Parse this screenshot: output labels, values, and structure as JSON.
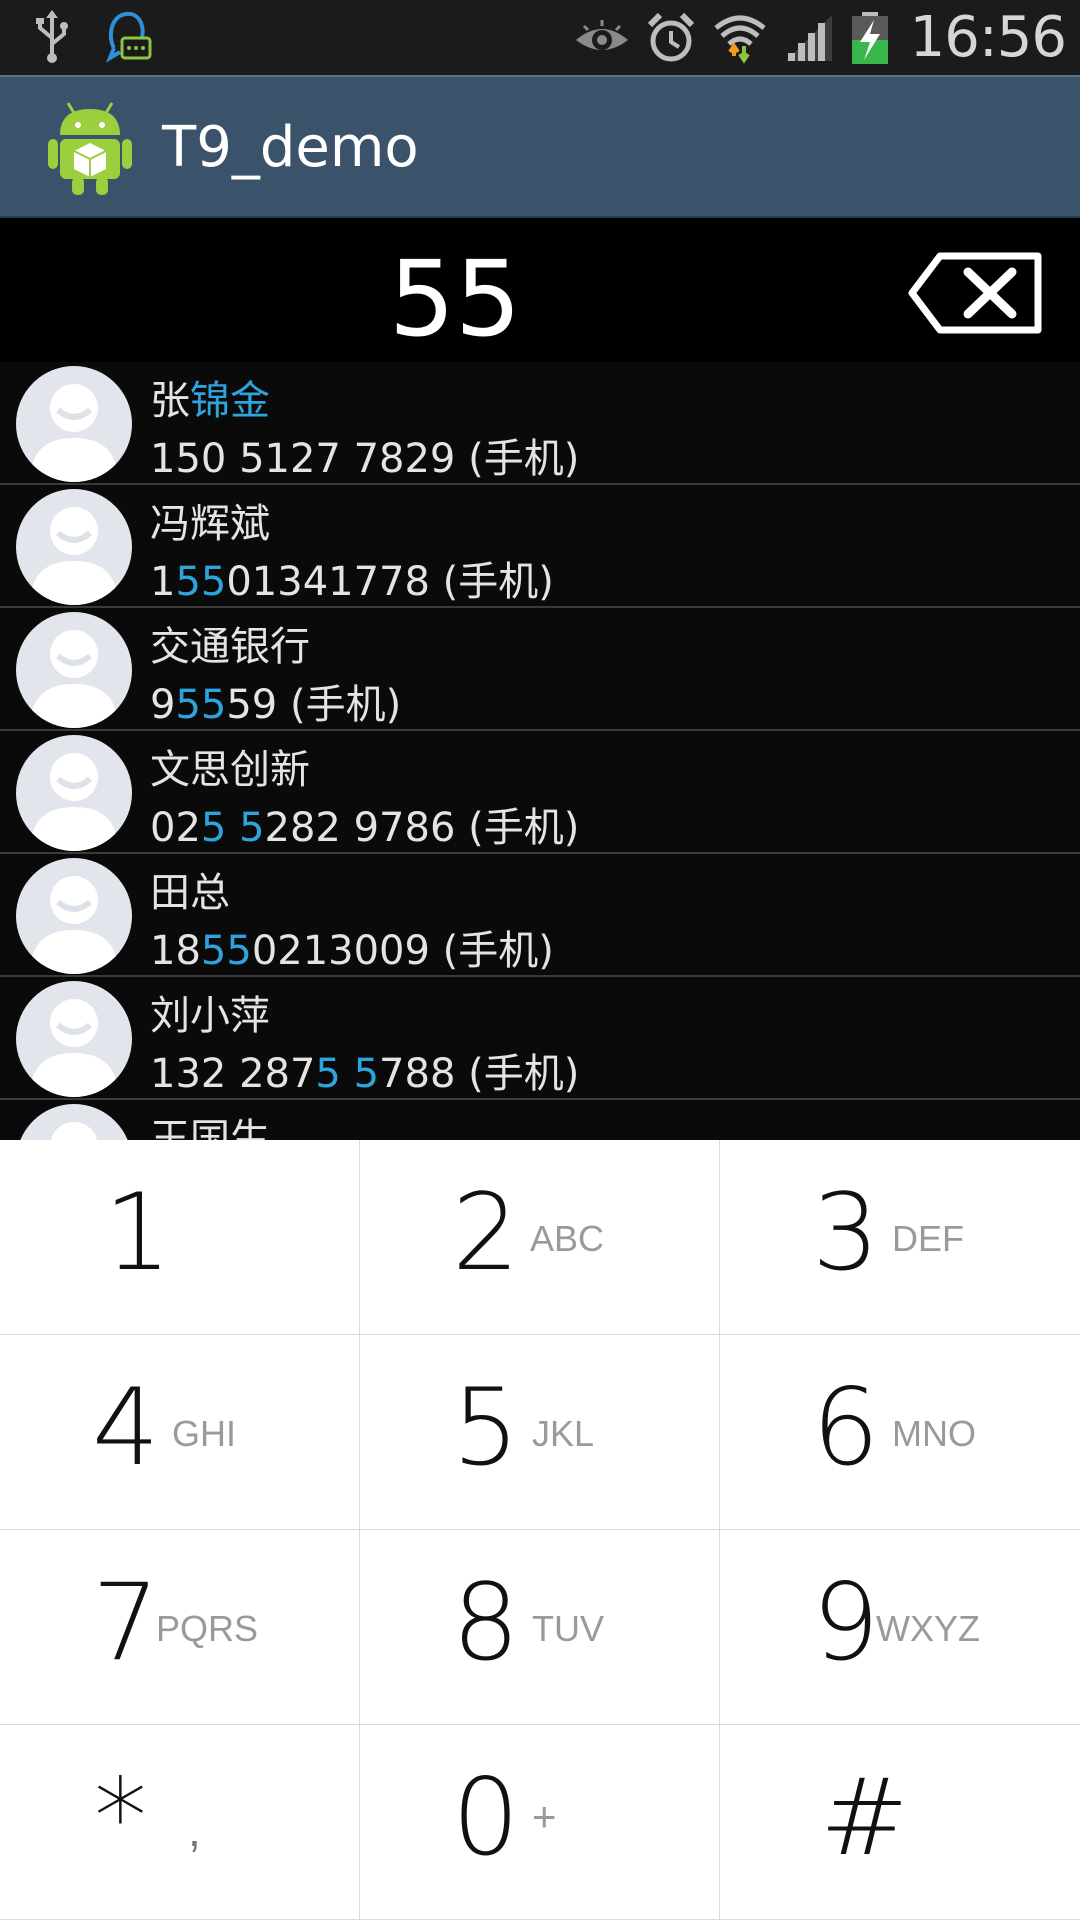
{
  "status_bar": {
    "time": "16:56",
    "left_icons": [
      "usb-icon",
      "qq-message-icon"
    ],
    "right_icons": [
      "eye-icon",
      "alarm-icon",
      "wifi-icon",
      "signal-icon",
      "battery-charging-icon"
    ]
  },
  "action_bar": {
    "title": "T9_demo",
    "icon": "android-app-icon"
  },
  "dialer": {
    "input_value": "55",
    "backspace_icon": "backspace-icon"
  },
  "contacts": [
    {
      "name_plain": "张",
      "name_hl": "锦金",
      "phone_segments": [
        {
          "t": "150 5127 7829 (手机)",
          "h": false
        }
      ]
    },
    {
      "name_plain": "冯辉斌",
      "name_hl": "",
      "phone_segments": [
        {
          "t": "1",
          "h": false
        },
        {
          "t": "55",
          "h": true
        },
        {
          "t": "01341778 (手机)",
          "h": false
        }
      ]
    },
    {
      "name_plain": "交通银行",
      "name_hl": "",
      "phone_segments": [
        {
          "t": "9",
          "h": false
        },
        {
          "t": "55",
          "h": true
        },
        {
          "t": "59 (手机)",
          "h": false
        }
      ]
    },
    {
      "name_plain": "文思创新",
      "name_hl": "",
      "phone_segments": [
        {
          "t": "02",
          "h": false
        },
        {
          "t": "5 5",
          "h": true
        },
        {
          "t": "282 9786 (手机)",
          "h": false
        }
      ]
    },
    {
      "name_plain": "田总",
      "name_hl": "",
      "phone_segments": [
        {
          "t": "18",
          "h": false
        },
        {
          "t": "55",
          "h": true
        },
        {
          "t": "0213009 (手机)",
          "h": false
        }
      ]
    },
    {
      "name_plain": "刘小萍",
      "name_hl": "",
      "phone_segments": [
        {
          "t": "132 287",
          "h": false
        },
        {
          "t": "5 5",
          "h": true
        },
        {
          "t": "788 (手机)",
          "h": false
        }
      ]
    },
    {
      "name_plain": "王国生",
      "name_hl": "",
      "phone_segments": []
    }
  ],
  "keypad": [
    {
      "digit": "1",
      "letters": ""
    },
    {
      "digit": "2",
      "letters": "ABC"
    },
    {
      "digit": "3",
      "letters": "DEF"
    },
    {
      "digit": "4",
      "letters": "GHI"
    },
    {
      "digit": "5",
      "letters": "JKL"
    },
    {
      "digit": "6",
      "letters": "MNO"
    },
    {
      "digit": "7",
      "letters": "PQRS"
    },
    {
      "digit": "8",
      "letters": "TUV"
    },
    {
      "digit": "9",
      "letters": "WXYZ"
    },
    {
      "digit": "*",
      "letters": ","
    },
    {
      "digit": "0",
      "letters": "+"
    },
    {
      "digit": "#",
      "letters": ""
    }
  ],
  "colors": {
    "highlight": "#2ea4dc",
    "action_bar": "#3a526a",
    "status_bar": "#1b1b1b"
  }
}
